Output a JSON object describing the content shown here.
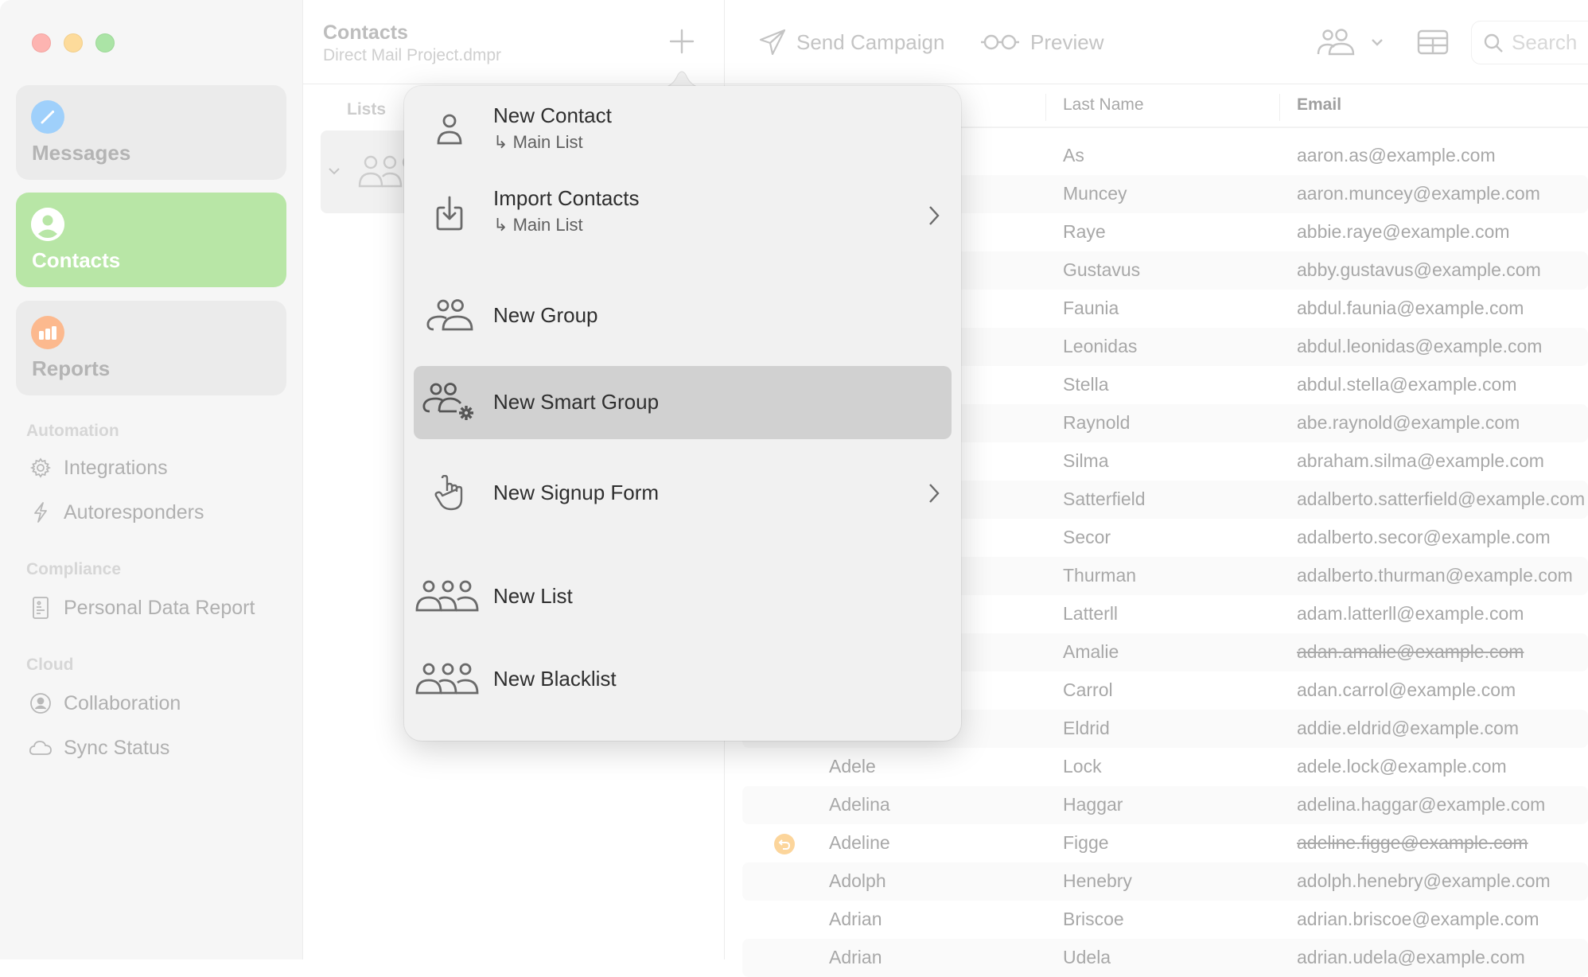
{
  "window": {
    "traffic_lights": [
      "close",
      "minimize",
      "zoom"
    ]
  },
  "sidebar": {
    "cards": [
      {
        "label": "Messages",
        "icon": "pencil-icon",
        "color": "#9fd0fb",
        "active": false
      },
      {
        "label": "Contacts",
        "icon": "person-icon",
        "color": "#ffffff",
        "active": true
      },
      {
        "label": "Reports",
        "icon": "chart-icon",
        "color": "#fcb98e",
        "active": false
      }
    ],
    "sections": [
      {
        "title": "Automation",
        "items": [
          {
            "label": "Integrations",
            "icon": "gear-icon"
          },
          {
            "label": "Autoresponders",
            "icon": "bolt-icon"
          }
        ]
      },
      {
        "title": "Compliance",
        "items": [
          {
            "label": "Personal Data Report",
            "icon": "document-icon"
          }
        ]
      },
      {
        "title": "Cloud",
        "items": [
          {
            "label": "Collaboration",
            "icon": "person-circle-icon"
          },
          {
            "label": "Sync Status",
            "icon": "cloud-icon"
          }
        ]
      }
    ]
  },
  "list_panel": {
    "title": "Contacts",
    "subtitle": "Direct Mail Project.dmpr",
    "add_button": "plus-icon",
    "section_label": "Lists"
  },
  "toolbar": {
    "send_campaign": "Send Campaign",
    "preview": "Preview",
    "search_placeholder": "Search"
  },
  "table": {
    "columns": [
      "",
      "Last Name",
      "Email"
    ],
    "rows": [
      {
        "first": "",
        "last": "As",
        "email": "aaron.as@example.com",
        "strike": false,
        "icon": false
      },
      {
        "first": "",
        "last": "Muncey",
        "email": "aaron.muncey@example.com",
        "strike": false,
        "icon": false
      },
      {
        "first": "",
        "last": "Raye",
        "email": "abbie.raye@example.com",
        "strike": false,
        "icon": false
      },
      {
        "first": "",
        "last": "Gustavus",
        "email": "abby.gustavus@example.com",
        "strike": false,
        "icon": false
      },
      {
        "first": "",
        "last": "Faunia",
        "email": "abdul.faunia@example.com",
        "strike": false,
        "icon": false
      },
      {
        "first": "",
        "last": "Leonidas",
        "email": "abdul.leonidas@example.com",
        "strike": false,
        "icon": false
      },
      {
        "first": "",
        "last": "Stella",
        "email": "abdul.stella@example.com",
        "strike": false,
        "icon": false
      },
      {
        "first": "",
        "last": "Raynold",
        "email": "abe.raynold@example.com",
        "strike": false,
        "icon": false
      },
      {
        "first": "",
        "last": "Silma",
        "email": "abraham.silma@example.com",
        "strike": false,
        "icon": false
      },
      {
        "first": "",
        "last": "Satterfield",
        "email": "adalberto.satterfield@example.com",
        "strike": false,
        "icon": false
      },
      {
        "first": "",
        "last": "Secor",
        "email": "adalberto.secor@example.com",
        "strike": false,
        "icon": false
      },
      {
        "first": "",
        "last": "Thurman",
        "email": "adalberto.thurman@example.com",
        "strike": false,
        "icon": false
      },
      {
        "first": "",
        "last": "Latterll",
        "email": "adam.latterll@example.com",
        "strike": false,
        "icon": false
      },
      {
        "first": "",
        "last": "Amalie",
        "email": "adan.amalie@example.com",
        "strike": true,
        "icon": false
      },
      {
        "first": "",
        "last": "Carrol",
        "email": "adan.carrol@example.com",
        "strike": false,
        "icon": false
      },
      {
        "first": "",
        "last": "Eldrid",
        "email": "addie.eldrid@example.com",
        "strike": false,
        "icon": false
      },
      {
        "first": "Adele",
        "last": "Lock",
        "email": "adele.lock@example.com",
        "strike": false,
        "icon": false
      },
      {
        "first": "Adelina",
        "last": "Haggar",
        "email": "adelina.haggar@example.com",
        "strike": false,
        "icon": false
      },
      {
        "first": "Adeline",
        "last": "Figge",
        "email": "adeline.figge@example.com",
        "strike": true,
        "icon": true
      },
      {
        "first": "Adolph",
        "last": "Henebry",
        "email": "adolph.henebry@example.com",
        "strike": false,
        "icon": false
      },
      {
        "first": "Adrian",
        "last": "Briscoe",
        "email": "adrian.briscoe@example.com",
        "strike": false,
        "icon": false
      },
      {
        "first": "Adrian",
        "last": "Udela",
        "email": "adrian.udela@example.com",
        "strike": false,
        "icon": false
      }
    ],
    "status_icon_color": "#fcd59b"
  },
  "menu": {
    "items": [
      {
        "label": "New Contact",
        "sub": "Main List",
        "icon": "person-icon",
        "submenu": false,
        "highlighted": false
      },
      {
        "label": "Import Contacts",
        "sub": "Main List",
        "icon": "import-icon",
        "submenu": true,
        "highlighted": false
      },
      {
        "label": "New Group",
        "sub": "",
        "icon": "group-icon",
        "submenu": false,
        "highlighted": false
      },
      {
        "label": "New Smart Group",
        "sub": "",
        "icon": "smart-group-icon",
        "submenu": false,
        "highlighted": true
      },
      {
        "label": "New Signup Form",
        "sub": "",
        "icon": "hand-pointer-icon",
        "submenu": true,
        "highlighted": false
      },
      {
        "label": "New List",
        "sub": "",
        "icon": "list-people-icon",
        "submenu": false,
        "highlighted": false
      },
      {
        "label": "New Blacklist",
        "sub": "",
        "icon": "blacklist-people-icon",
        "submenu": false,
        "highlighted": false
      }
    ],
    "sub_arrow": "↳"
  }
}
